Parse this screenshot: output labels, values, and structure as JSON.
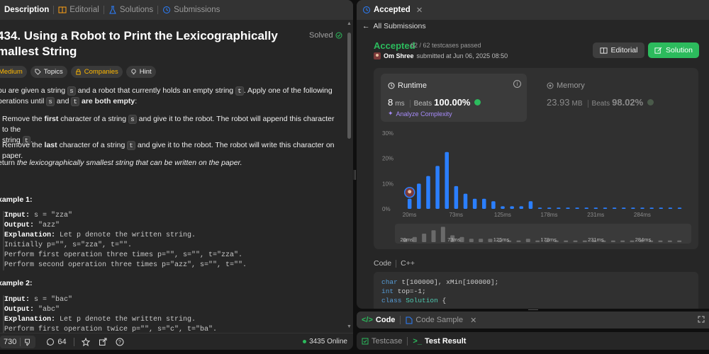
{
  "left_tabs": [
    {
      "label": "Description",
      "active": true
    },
    {
      "label": "Editorial",
      "active": false
    },
    {
      "label": "Solutions",
      "active": false
    },
    {
      "label": "Submissions",
      "active": false
    }
  ],
  "problem": {
    "title": "434. Using a Robot to Print the Lexicographically smallest String",
    "title_line1": "434. Using a Robot to Print the Lexicographically",
    "title_line2": "mallest String",
    "solved_label": "Solved",
    "chips": {
      "difficulty": "Medium",
      "topics": "Topics",
      "companies": "Companies",
      "hint": "Hint"
    },
    "intro": {
      "a": "ou are given a string ",
      "s": "s",
      "b": " and a robot that currently holds an empty string ",
      "t": "t",
      "c": ". Apply one of the following",
      "d": "perations until ",
      "e": " and ",
      "f": " are both empty",
      "g": ":"
    },
    "bullet1": {
      "a": "Remove the ",
      "b": "first",
      "c": " character of a string ",
      "d": " and give it to the robot. The robot will append this character to the",
      "e": "string ",
      "f": "."
    },
    "bullet2": {
      "a": "Remove the ",
      "b": "last",
      "c": " character of a string ",
      "d": " and give it to the robot. The robot will write this character on paper."
    },
    "return_text": {
      "a": "eturn ",
      "b": "the lexicographically smallest string that can be written on the paper."
    },
    "example1": {
      "title": "xample 1:",
      "input_label": "Input:",
      "input": " s = \"zza\"",
      "output_label": "Output:",
      "output": " \"azz\"",
      "explanation_label": "Explanation:",
      "explanation": " Let p denote the written string.",
      "line1": "Initially p=\"\", s=\"zza\", t=\"\".",
      "line2": "Perform first operation three times p=\"\", s=\"\", t=\"zza\".",
      "line3": "Perform second operation three times p=\"azz\", s=\"\", t=\"\"."
    },
    "example2": {
      "title": "xample 2:",
      "input_label": "Input:",
      "input": " s = \"bac\"",
      "output_label": "Output:",
      "output": " \"abc\"",
      "explanation_label": "Explanation:",
      "explanation": " Let p denote the written string.",
      "line1": "Perform first operation twice p=\"\", s=\"c\", t=\"ba\"."
    }
  },
  "footer": {
    "upvotes": "730",
    "comments": "64",
    "online": "3435 Online"
  },
  "right_tabs": [
    {
      "label": "Accepted",
      "active": true
    }
  ],
  "submission": {
    "back_label": "All Submissions",
    "status": "Accepted",
    "passed": "62 / 62 testcases passed",
    "user": "Om Shree",
    "submitted": "submitted at Jun 06, 2025 08:50",
    "editorial_btn": "Editorial",
    "solution_btn": "Solution",
    "runtime_label": "Runtime",
    "runtime_value": "8",
    "runtime_unit": "ms",
    "runtime_beats_label": "Beats",
    "runtime_beats": "100.00%",
    "analyze_label": "Analyze Complexity",
    "memory_label": "Memory",
    "memory_value": "23.93",
    "memory_unit": "MB",
    "memory_beats_label": "Beats",
    "memory_beats": "98.02%"
  },
  "chart_data": {
    "type": "bar",
    "y_ticks": [
      "30%",
      "20%",
      "10%",
      "0%"
    ],
    "ylim": [
      0,
      30
    ],
    "x_tick_labels": [
      "20ms",
      "73ms",
      "125ms",
      "178ms",
      "231ms",
      "284ms"
    ],
    "values": [
      4,
      10,
      13,
      17,
      22.5,
      9,
      6,
      4,
      4,
      3,
      1,
      1,
      1,
      3,
      0.5,
      0.5,
      0.5,
      0.5,
      0.5,
      0.5,
      0.5,
      0.5,
      0.5,
      0.5,
      0.5,
      0.5,
      0.5,
      0.5,
      0.5,
      0.5
    ],
    "highlight_index": 0,
    "bar_color": "#2b7fff",
    "mini_values": [
      2,
      3,
      5,
      7,
      9,
      4,
      3,
      2,
      2,
      2,
      1,
      1,
      1,
      2,
      1,
      1,
      1,
      1,
      1,
      1,
      1,
      1,
      1,
      1,
      1,
      1,
      1,
      1,
      1,
      1
    ]
  },
  "code": {
    "label": "Code",
    "lang": "C++",
    "lines": {
      "l1a": "char",
      "l1b": " t[100000], xMin[100000];",
      "l2a": "int",
      "l2b": " top=-1;",
      "l3a": "class",
      "l3b": " Solution",
      "l3c": " {"
    }
  },
  "code_panel_tabs": {
    "code": "Code",
    "code_sample": "Code Sample"
  },
  "test_panel_tabs": {
    "testcase": "Testcase",
    "test_result": "Test Result"
  },
  "colors": {
    "accent_green": "#2cbb5d",
    "medium": "#ffb800",
    "bar_blue": "#2b7fff",
    "purple": "#a78bfa"
  }
}
